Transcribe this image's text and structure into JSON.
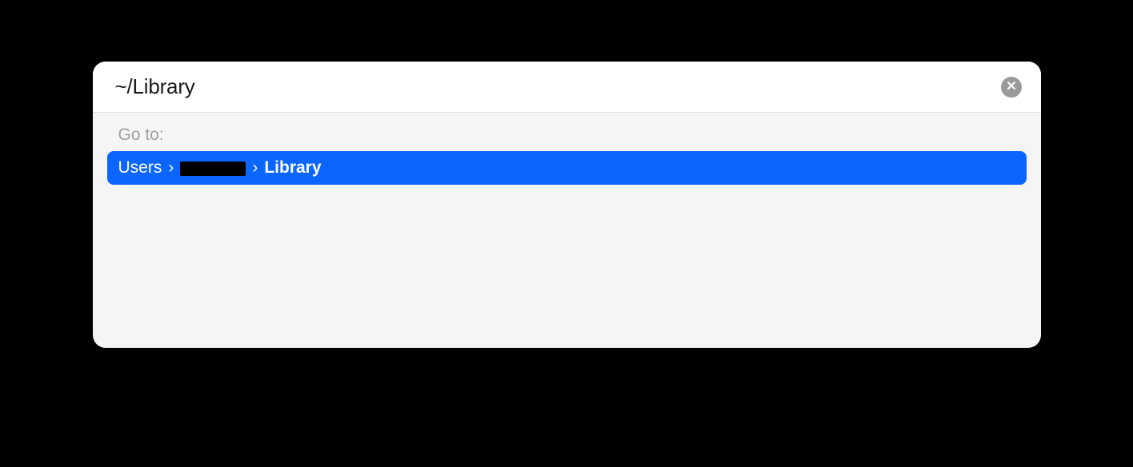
{
  "search": {
    "value": "~/Library"
  },
  "section_label": "Go to:",
  "result": {
    "segments": [
      {
        "text": "Users",
        "bold": false,
        "redacted": false
      },
      {
        "text": "",
        "bold": false,
        "redacted": true
      },
      {
        "text": "Library",
        "bold": true,
        "redacted": false
      }
    ],
    "separator": "›"
  },
  "colors": {
    "accent": "#0a66ff"
  }
}
